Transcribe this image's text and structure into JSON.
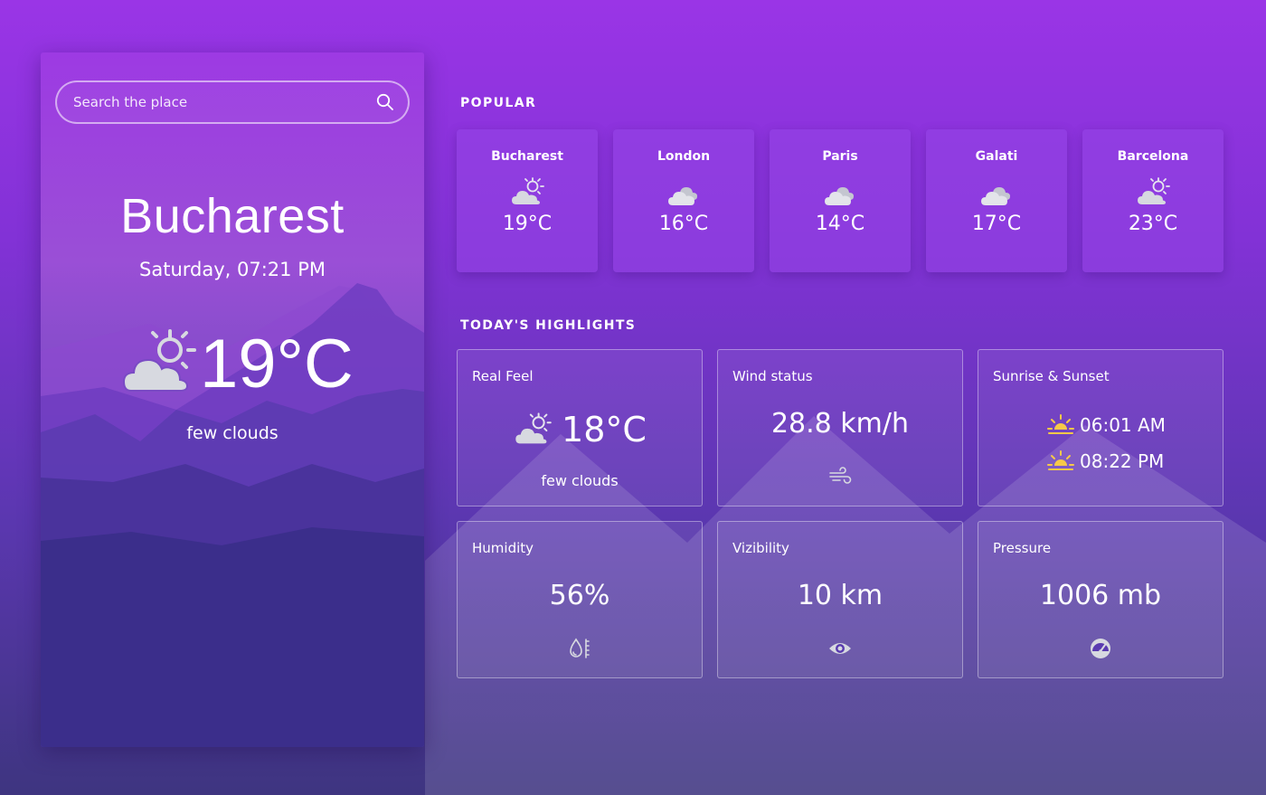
{
  "search": {
    "placeholder": "Search the place"
  },
  "current": {
    "city": "Bucharest",
    "datetime": "Saturday, 07:21 PM",
    "temperature": "19°C",
    "description": "few clouds",
    "icon": "sun-cloud-icon"
  },
  "popular": {
    "title": "POPULAR",
    "cities": [
      {
        "name": "Bucharest",
        "temp": "19°C",
        "icon": "sun-cloud-icon"
      },
      {
        "name": "London",
        "temp": "16°C",
        "icon": "clouds-icon"
      },
      {
        "name": "Paris",
        "temp": "14°C",
        "icon": "clouds-icon"
      },
      {
        "name": "Galati",
        "temp": "17°C",
        "icon": "clouds-icon"
      },
      {
        "name": "Barcelona",
        "temp": "23°C",
        "icon": "sun-cloud-icon"
      }
    ]
  },
  "highlights": {
    "title": "TODAY'S HIGHLIGHTS",
    "real_feel": {
      "label": "Real Feel",
      "value": "18°C",
      "description": "few clouds"
    },
    "wind": {
      "label": "Wind status",
      "value": "28.8 km/h",
      "icon": "wind-icon"
    },
    "sun": {
      "label": "Sunrise & Sunset",
      "sunrise": "06:01 AM",
      "sunset": "08:22 PM"
    },
    "humidity": {
      "label": "Humidity",
      "value": "56%",
      "icon": "humidity-icon"
    },
    "visibility": {
      "label": "Vizibility",
      "value": "10 km",
      "icon": "eye-icon"
    },
    "pressure": {
      "label": "Pressure",
      "value": "1006 mb",
      "icon": "gauge-icon"
    }
  },
  "colors": {
    "background_top": "#9a35e6",
    "background_bottom": "#3e3580",
    "sun_yellow": "#f7c948",
    "cloud_gray": "#d7d9e0"
  }
}
